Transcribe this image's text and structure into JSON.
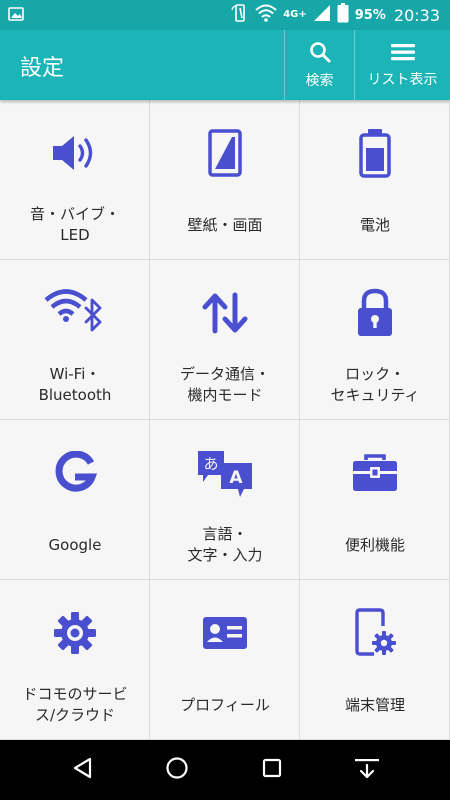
{
  "status_bar": {
    "network": "4G+",
    "battery_percent": "95%",
    "time": "20:33"
  },
  "app_bar": {
    "title": "設定",
    "search_label": "検索",
    "list_label": "リスト表示"
  },
  "tiles": [
    {
      "label": "音・バイブ・\nLED",
      "icon": "volume-icon"
    },
    {
      "label": "壁紙・画面",
      "icon": "wallpaper-icon"
    },
    {
      "label": "電池",
      "icon": "battery-icon"
    },
    {
      "label": "Wi-Fi・\nBluetooth",
      "icon": "wifi-bluetooth-icon"
    },
    {
      "label": "データ通信・\n機内モード",
      "icon": "data-transfer-icon"
    },
    {
      "label": "ロック・\nセキュリティ",
      "icon": "lock-icon"
    },
    {
      "label": "Google",
      "icon": "google-icon"
    },
    {
      "label": "言語・\n文字・入力",
      "icon": "language-icon"
    },
    {
      "label": "便利機能",
      "icon": "toolbox-icon"
    },
    {
      "label": "ドコモのサービ\nス/クラウド",
      "icon": "gear-icon"
    },
    {
      "label": "プロフィール",
      "icon": "profile-card-icon"
    },
    {
      "label": "端末管理",
      "icon": "device-settings-icon"
    }
  ],
  "colors": {
    "accent": "#1bb4b7",
    "icon": "#4a4fcf"
  }
}
